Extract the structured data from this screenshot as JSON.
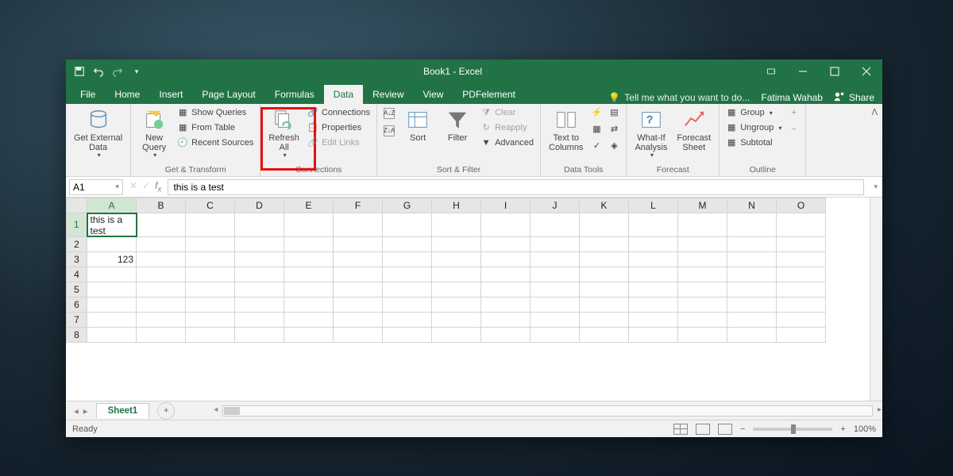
{
  "title": "Book1 - Excel",
  "user": "Fatima Wahab",
  "share_label": "Share",
  "tell_me": "Tell me what you want to do...",
  "tabs": [
    "File",
    "Home",
    "Insert",
    "Page Layout",
    "Formulas",
    "Data",
    "Review",
    "View",
    "PDFelement"
  ],
  "active_tab": "Data",
  "ribbon": {
    "get_external": {
      "label": "Get External\nData",
      "group": ""
    },
    "transform": {
      "group": "Get & Transform",
      "new_query": "New\nQuery",
      "show_queries": "Show Queries",
      "from_table": "From Table",
      "recent_sources": "Recent Sources"
    },
    "connections": {
      "group": "Connections",
      "refresh_all": "Refresh\nAll",
      "connections": "Connections",
      "properties": "Properties",
      "edit_links": "Edit Links"
    },
    "sort_filter": {
      "group": "Sort & Filter",
      "sort": "Sort",
      "filter": "Filter",
      "clear": "Clear",
      "reapply": "Reapply",
      "advanced": "Advanced"
    },
    "data_tools": {
      "group": "Data Tools",
      "text_to_columns": "Text to\nColumns"
    },
    "forecast": {
      "group": "Forecast",
      "what_if": "What-If\nAnalysis",
      "forecast_sheet": "Forecast\nSheet"
    },
    "outline": {
      "group": "Outline",
      "group_btn": "Group",
      "ungroup": "Ungroup",
      "subtotal": "Subtotal"
    }
  },
  "formula_bar": {
    "cell_ref": "A1",
    "value": "this is a test"
  },
  "columns": [
    "A",
    "B",
    "C",
    "D",
    "E",
    "F",
    "G",
    "H",
    "I",
    "J",
    "K",
    "L",
    "M",
    "N",
    "O"
  ],
  "rows": [
    1,
    2,
    3,
    4,
    5,
    6,
    7,
    8
  ],
  "cells": {
    "A1": "this is a test",
    "A3": "123"
  },
  "sheet_tab": "Sheet1",
  "status": "Ready",
  "zoom": "100%"
}
